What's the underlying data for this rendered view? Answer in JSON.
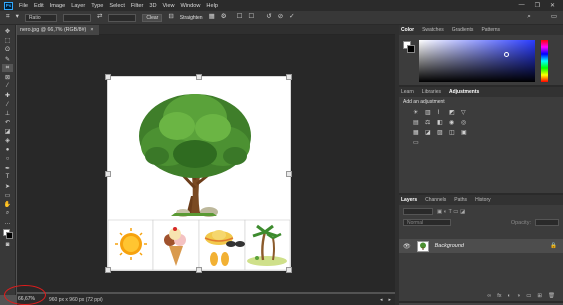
{
  "menu": [
    "File",
    "Edit",
    "Image",
    "Layer",
    "Type",
    "Select",
    "Filter",
    "3D",
    "View",
    "Window",
    "Help"
  ],
  "options": {
    "ratio_label": "Ratio",
    "clear_label": "Clear",
    "straighten_label": "Straighten"
  },
  "document": {
    "tab_title": "nero.jpg @ 66,7% (RGB/8#)",
    "close_glyph": "×"
  },
  "status": {
    "zoom": "66,67%",
    "info": "960 px x 960 px (72 ppi)"
  },
  "color_panel": {
    "tabs": [
      "Color",
      "Swatches",
      "Gradients",
      "Patterns"
    ]
  },
  "adjustments_panel": {
    "tabs": [
      "Learn",
      "Libraries",
      "Adjustments"
    ],
    "heading": "Add an adjustment"
  },
  "layers_panel": {
    "tabs": [
      "Layers",
      "Channels",
      "Paths",
      "History"
    ],
    "blend_mode": "Normal",
    "opacity_label": "Opacity:",
    "layer_name": "Background"
  },
  "colors": {
    "accent": "#31a8ff",
    "zoom_highlight": "#e21c1c"
  }
}
